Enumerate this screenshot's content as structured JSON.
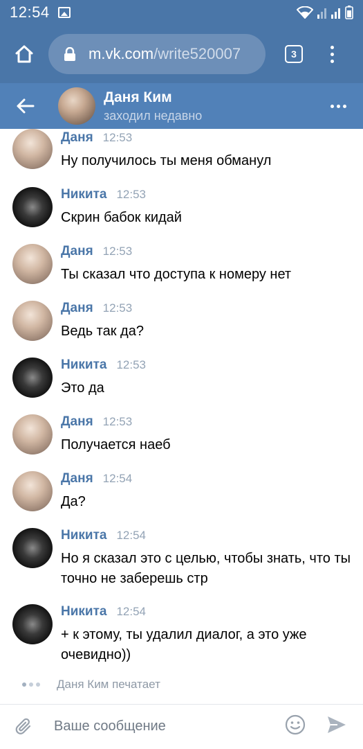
{
  "status": {
    "time": "12:54"
  },
  "browser": {
    "url_host": "m.vk.com",
    "url_path": "/write520007",
    "tab_count": "3"
  },
  "chat": {
    "name": "Даня Ким",
    "status": "заходил недавно"
  },
  "messages": [
    {
      "author": "Даня",
      "time": "12:53",
      "text": "Ну получилось ты меня обманул",
      "avatar": "danya"
    },
    {
      "author": "Никита",
      "time": "12:53",
      "text": "Скрин бабок кидай",
      "avatar": "nikita"
    },
    {
      "author": "Даня",
      "time": "12:53",
      "text": "Ты сказал что доступа к номеру нет",
      "avatar": "danya"
    },
    {
      "author": "Даня",
      "time": "12:53",
      "text": "Ведь так да?",
      "avatar": "danya"
    },
    {
      "author": "Никита",
      "time": "12:53",
      "text": "Это да",
      "avatar": "nikita"
    },
    {
      "author": "Даня",
      "time": "12:53",
      "text": "Получается наеб",
      "avatar": "danya"
    },
    {
      "author": "Даня",
      "time": "12:54",
      "text": "Да?",
      "avatar": "danya"
    },
    {
      "author": "Никита",
      "time": "12:54",
      "text": "Но я сказал это с целью, чтобы знать, что ты точно не заберешь стр",
      "avatar": "nikita"
    },
    {
      "author": "Никита",
      "time": "12:54",
      "text": "+ к этому, ты удалил диалог, а это уже очевидно))",
      "avatar": "nikita"
    }
  ],
  "typing": "Даня Ким печатает",
  "composer": {
    "placeholder": "Ваше сообщение"
  },
  "colors": {
    "header": "#5181b8",
    "toolbar": "#4a76a8",
    "author_name": "#4a76a8",
    "time": "#93a3b5"
  }
}
